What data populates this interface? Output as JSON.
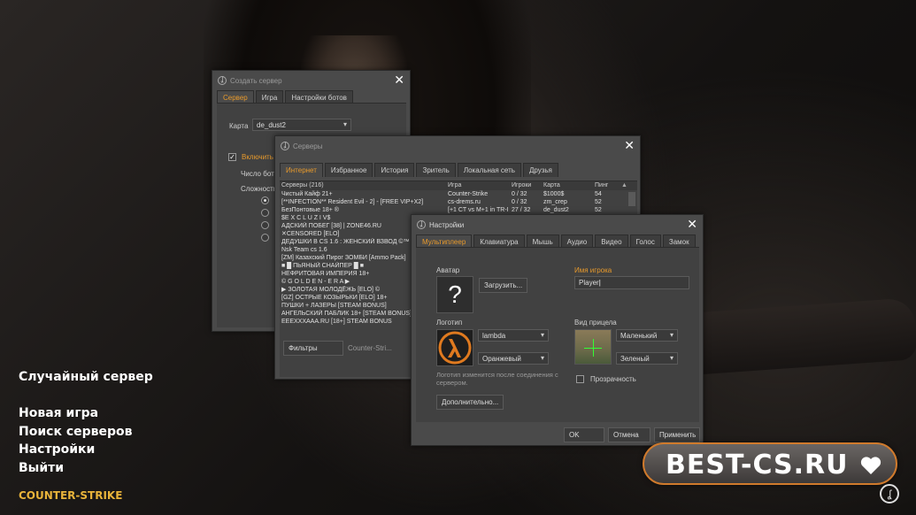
{
  "create_server": {
    "title": "Создать сервер",
    "tabs": [
      "Сервер",
      "Игра",
      "Настройки ботов"
    ],
    "map_label": "Карта",
    "map_value": "de_dust2",
    "enable_label": "Включить",
    "bots_count_label": "Число бот",
    "difficulty_label": "Сложность"
  },
  "servers": {
    "title": "Серверы",
    "tabs": [
      "Интернет",
      "Избранное",
      "История",
      "Зритель",
      "Локальная сеть",
      "Друзья"
    ],
    "columns": [
      "Серверы (216)",
      "Игра",
      "Игроки",
      "Карта",
      "Пинг"
    ],
    "rows": [
      [
        "Чистый Кайф 21+",
        "Counter-Strike",
        "0 / 32",
        "$1000$",
        "54"
      ],
      [
        "[**INFECTION** Resident Evil - 2] - [FREE VIP+X2]",
        "cs-drems.ru",
        "0 / 32",
        "zm_crep",
        "52"
      ],
      [
        "БезПонтовые 18+ ®",
        "[+1 CT vs M+1 in TR-I",
        "27 / 32",
        "de_dust2",
        "52"
      ],
      [
        "$E X C L U Z I V$",
        "",
        "",
        "",
        ""
      ],
      [
        "АДСКИЙ ПОБЕГ [38] | ZONE46.RU",
        "",
        "",
        "",
        ""
      ],
      [
        "✕CENSORED [ELO]",
        "",
        "",
        "",
        ""
      ],
      [
        "ДЕДУШКИ В CS 1.6 : ЖЕНСКИЙ ВЗВОД ©™",
        "",
        "",
        "",
        ""
      ],
      [
        "Nsk Team cs 1.6",
        "",
        "",
        "",
        ""
      ],
      [
        "[ZM] Казахский Пирог ЗОМБИ [Ammo Pack]",
        "",
        "",
        "",
        ""
      ],
      [
        "■ █ ПЬЯНЫЙ СНАЙПЕР █ ■",
        "",
        "",
        "",
        ""
      ],
      [
        "НЕФРИТОВАЯ ИМПЕРИЯ 18+",
        "",
        "",
        "",
        ""
      ],
      [
        "© G O L D E N - E R A ▶",
        "",
        "",
        "",
        ""
      ],
      [
        "▶ ЗОЛОТАЯ МОЛОДЁЖЬ [ELO] ©",
        "",
        "",
        "",
        ""
      ],
      [
        "[GZ] ОСТРЫЕ КОЗЫРЬКИ [ELO] 18+",
        "",
        "",
        "",
        ""
      ],
      [
        "ПУШКИ + ЛАЗЕРЫ [STEAM BONUS]",
        "",
        "",
        "",
        ""
      ],
      [
        "АНГЕЛЬСКИЙ ПАБЛИК 18+ [STEAM BONUS]",
        "",
        "",
        "",
        ""
      ],
      [
        "EEEXXXAAA.RU [18+] STEAM BONUS",
        "",
        "",
        "",
        ""
      ]
    ],
    "filters_label": "Фильтры",
    "game_filter": "Counter-Stri..."
  },
  "settings": {
    "title": "Настройки",
    "tabs": [
      "Мультиплеер",
      "Клавиатура",
      "Мышь",
      "Аудио",
      "Видео",
      "Голос",
      "Замок"
    ],
    "avatar_label": "Аватар",
    "upload_button": "Загрузить...",
    "player_name_label": "Имя игрока",
    "player_name_value": "Player",
    "logo_label": "Логотип",
    "logo_value": "lambda",
    "logo_color": "Оранжевый",
    "logo_note": "Логотип изменится после соединения с сервером.",
    "advanced_button": "Дополнительно...",
    "crosshair_label": "Вид прицела",
    "crosshair_size": "Маленький",
    "crosshair_color": "Зеленый",
    "transparency_label": "Прозрачность",
    "ok": "OK",
    "cancel": "Отмена",
    "apply": "Применить"
  },
  "main_menu": {
    "random_server": "Случайный сервер",
    "new_game": "Новая игра",
    "find_servers": "Поиск серверов",
    "settings": "Настройки",
    "exit": "Выйти",
    "logo_text": "COUNTER-STRIKE"
  },
  "badge": {
    "text": "BEST-CS.RU"
  },
  "colors": {
    "accent": "#e89a2c",
    "window_bg": "#4a4a4a"
  }
}
